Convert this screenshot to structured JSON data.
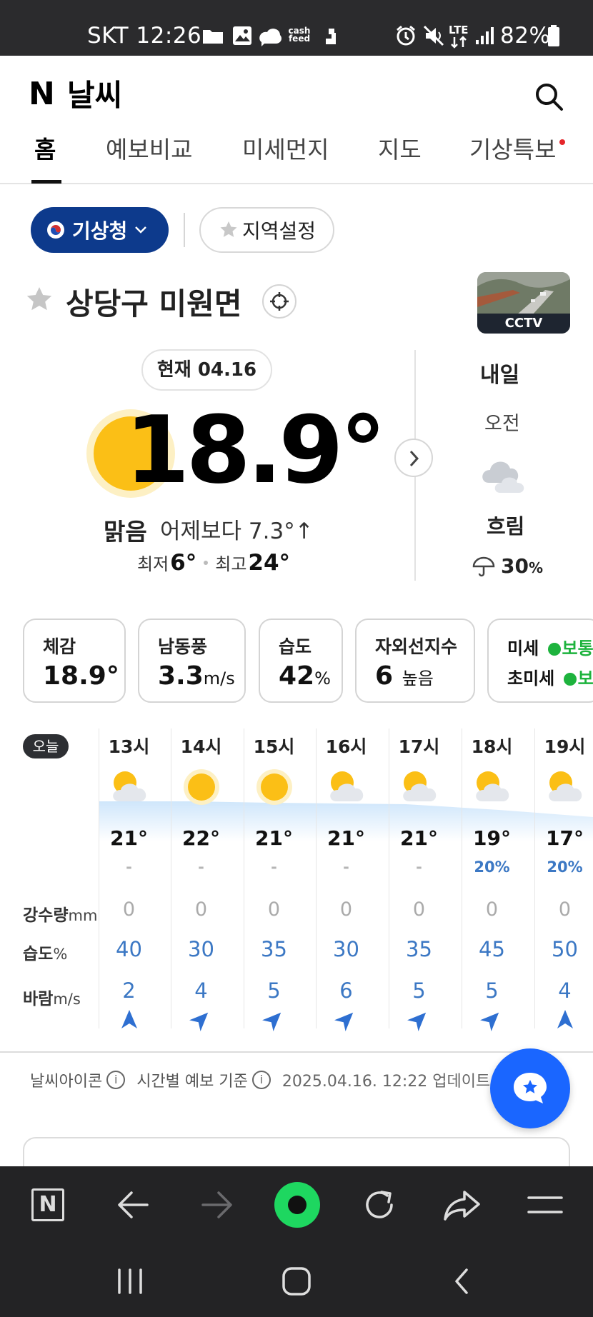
{
  "status_bar": {
    "carrier_time": "SKT 12:26",
    "battery": "82%",
    "network": "LTE",
    "cash_label": "cash feed"
  },
  "header": {
    "logo_letter": "N",
    "title": "날씨",
    "tabs": [
      {
        "label": "홈",
        "active": true
      },
      {
        "label": "예보비교",
        "active": false
      },
      {
        "label": "미세먼지",
        "active": false
      },
      {
        "label": "지도",
        "active": false
      },
      {
        "label": "기상특보",
        "active": false,
        "has_new_dot": true
      }
    ]
  },
  "source_chip": {
    "label": "기상청"
  },
  "region_chip": {
    "label": "지역설정"
  },
  "location": {
    "name": "상당구 미원면"
  },
  "cctv": {
    "label": "CCTV"
  },
  "current": {
    "date_label": "현재 04.16",
    "temperature": "18.9°",
    "condition": "맑음",
    "compare": "어제보다 7.3°↑",
    "min_label": "최저",
    "min_value": "6°",
    "max_label": "최고",
    "max_value": "24°"
  },
  "tomorrow": {
    "label": "내일",
    "period": "오전",
    "condition": "흐림",
    "precip": "30",
    "precip_unit": "%"
  },
  "cards": [
    {
      "label": "체감",
      "value": "18.9°",
      "unit": ""
    },
    {
      "label": "남동풍",
      "value": "3.3",
      "unit": "m/s"
    },
    {
      "label": "습도",
      "value": "42",
      "unit": "%"
    },
    {
      "label": "자외선지수",
      "value": "6",
      "unit": "높음"
    },
    {
      "label1": "미세",
      "status1": "보통",
      "label2": "초미세",
      "status2": "보"
    }
  ],
  "hourly": {
    "today_badge": "오늘",
    "row_labels": {
      "precip": "강수량",
      "precip_unit": "mm",
      "humidity": "습도",
      "humidity_unit": "%",
      "wind": "바람",
      "wind_unit": "m/s"
    },
    "hours": [
      {
        "time": "13시",
        "icon": "partly-cloudy-icon",
        "temp": "21°",
        "pop": "-",
        "precip": "0",
        "humidity": "40",
        "wind": "2"
      },
      {
        "time": "14시",
        "icon": "sun-icon",
        "temp": "22°",
        "pop": "-",
        "precip": "0",
        "humidity": "30",
        "wind": "4"
      },
      {
        "time": "15시",
        "icon": "sun-icon",
        "temp": "21°",
        "pop": "-",
        "precip": "0",
        "humidity": "35",
        "wind": "5"
      },
      {
        "time": "16시",
        "icon": "partly-cloudy-icon",
        "temp": "21°",
        "pop": "-",
        "precip": "0",
        "humidity": "30",
        "wind": "6"
      },
      {
        "time": "17시",
        "icon": "partly-cloudy-icon",
        "temp": "21°",
        "pop": "-",
        "precip": "0",
        "humidity": "35",
        "wind": "5"
      },
      {
        "time": "18시",
        "icon": "partly-cloudy-icon",
        "temp": "19°",
        "pop": "20%",
        "precip": "0",
        "humidity": "45",
        "wind": "5"
      },
      {
        "time": "19시",
        "icon": "partly-cloudy-icon",
        "temp": "17°",
        "pop": "20%",
        "precip": "0",
        "humidity": "50",
        "wind": "4"
      }
    ]
  },
  "footer_info": {
    "weather_icon_label": "날씨아이콘",
    "hourly_basis_label": "시간별 예보 기준",
    "updated": "2025.04.16. 12:22 업데이트"
  },
  "colors": {
    "brand_navy": "#0d3a8c",
    "accent_blue": "#2e6fd1",
    "status_green": "#1db33d",
    "sun_yellow": "#fbbf16",
    "fab_blue": "#1a66ff",
    "browser_green": "#1ed760"
  }
}
